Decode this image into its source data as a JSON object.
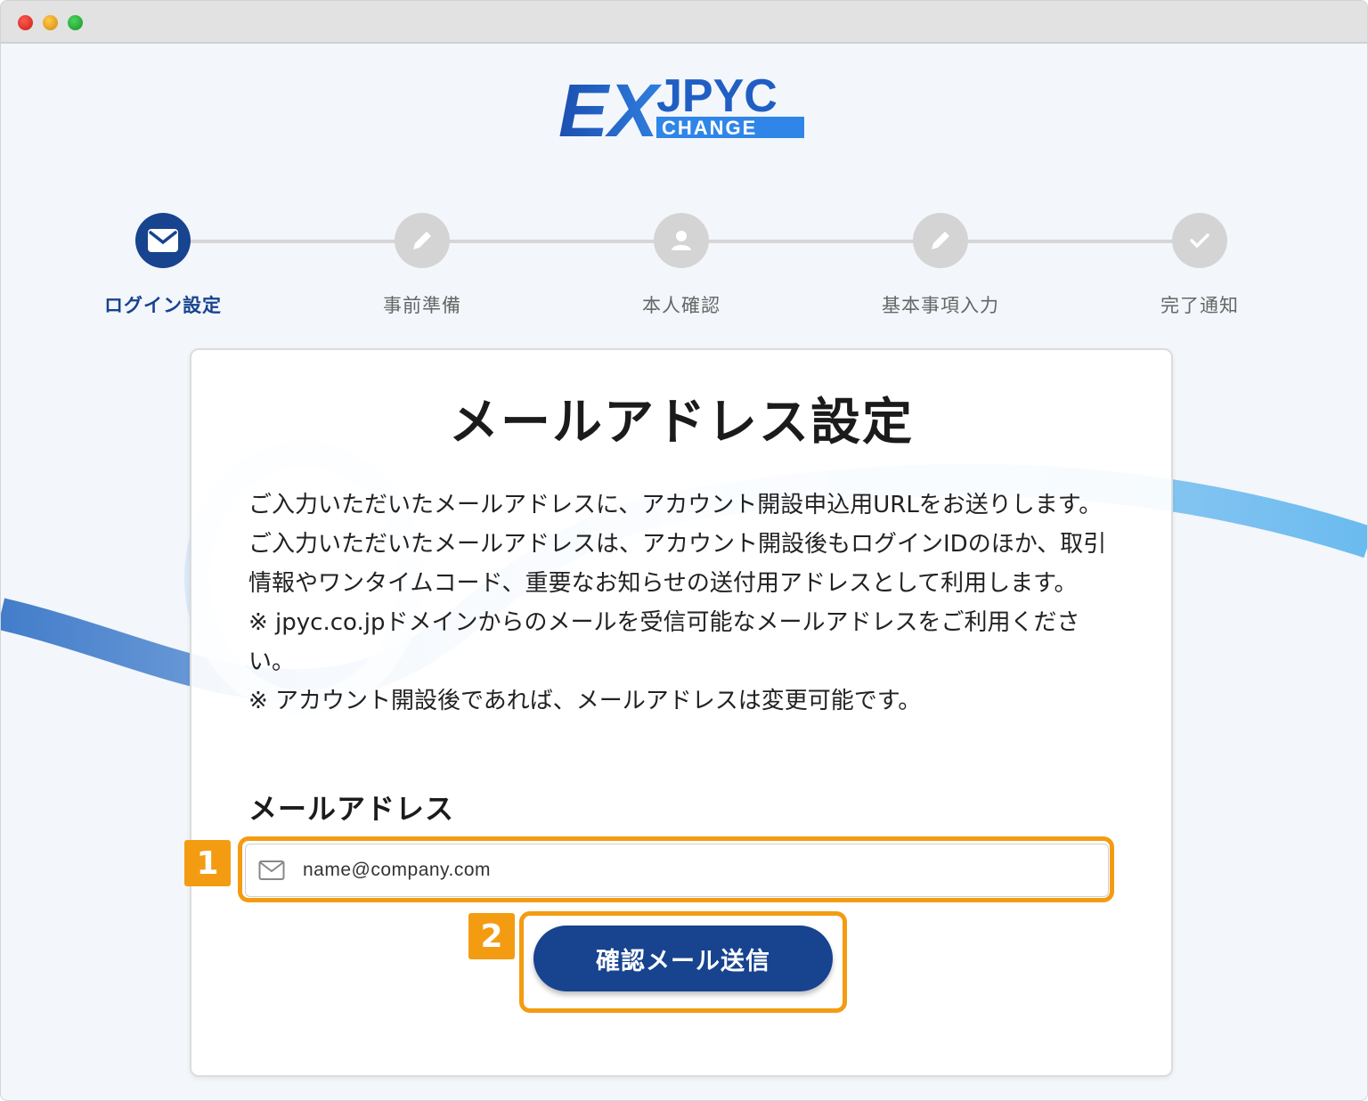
{
  "logo": {
    "ex": "EX",
    "jpyc": "JPYC",
    "change": "CHANGE"
  },
  "steps": [
    {
      "label": "ログイン設定",
      "icon": "mail-icon",
      "active": true
    },
    {
      "label": "事前準備",
      "icon": "pencil-icon",
      "active": false
    },
    {
      "label": "本人確認",
      "icon": "person-icon",
      "active": false
    },
    {
      "label": "基本事項入力",
      "icon": "pencil-icon",
      "active": false
    },
    {
      "label": "完了通知",
      "icon": "check-icon",
      "active": false
    }
  ],
  "card": {
    "title": "メールアドレス設定",
    "description": [
      "ご入力いただいたメールアドレスに、アカウント開設申込用URLをお送りします。ご入力いただいたメールアドレスは、アカウント開設後もログインIDのほか、取引情報やワンタイムコード、重要なお知らせの送付用アドレスとして利用します。",
      "※ jpyc.co.jpドメインからのメールを受信可能なメールアドレスをご利用ください。",
      "※ アカウント開設後であれば、メールアドレスは変更可能です。"
    ],
    "email_label": "メールアドレス",
    "email_placeholder": "name@company.com",
    "email_value": "",
    "submit_label": "確認メール送信"
  },
  "annotations": {
    "badge1": "1",
    "badge2": "2"
  },
  "colors": {
    "primary": "#17438f",
    "highlight": "#f39c12",
    "inactive_step": "#d4d4d4",
    "wave": "#3a86d6"
  }
}
